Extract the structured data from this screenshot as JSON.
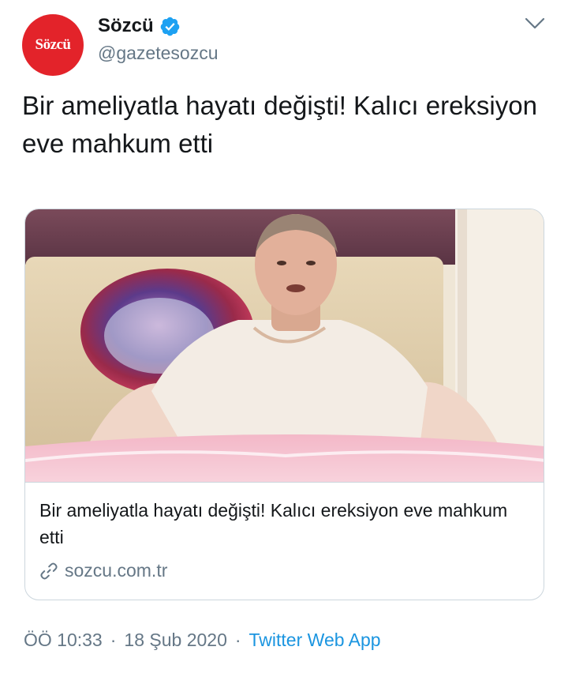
{
  "author": {
    "avatar_text": "Sözcü",
    "display_name": "Sözcü",
    "handle": "@gazetesozcu",
    "verified_icon": "verified-badge-icon"
  },
  "tweet": {
    "text": "Bir ameliyatla hayatı değişti! Kalıcı ereksiyon eve mahkum etti"
  },
  "card": {
    "title": "Bir ameliyatla hayatı değişti! Kalıcı ereksiyon eve mahkum etti",
    "domain": "sozcu.com.tr",
    "link_icon": "link-icon"
  },
  "meta": {
    "time": "ÖÖ 10:33",
    "separator": "·",
    "date": "18 Şub 2020",
    "source": "Twitter Web App"
  },
  "colors": {
    "brand_red": "#e3232a",
    "verified_blue": "#1da1f2",
    "link_blue": "#1b95e0",
    "secondary_text": "#657786",
    "border": "#ccd6dd"
  }
}
